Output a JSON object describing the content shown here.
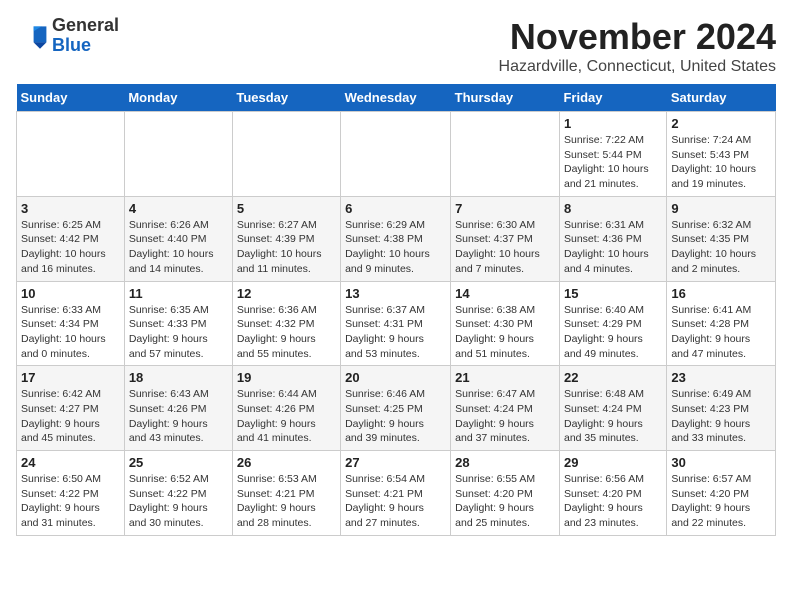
{
  "logo": {
    "line1": "General",
    "line2": "Blue"
  },
  "title": "November 2024",
  "location": "Hazardville, Connecticut, United States",
  "weekdays": [
    "Sunday",
    "Monday",
    "Tuesday",
    "Wednesday",
    "Thursday",
    "Friday",
    "Saturday"
  ],
  "weeks": [
    [
      {
        "day": "",
        "info": ""
      },
      {
        "day": "",
        "info": ""
      },
      {
        "day": "",
        "info": ""
      },
      {
        "day": "",
        "info": ""
      },
      {
        "day": "",
        "info": ""
      },
      {
        "day": "1",
        "info": "Sunrise: 7:22 AM\nSunset: 5:44 PM\nDaylight: 10 hours\nand 21 minutes."
      },
      {
        "day": "2",
        "info": "Sunrise: 7:24 AM\nSunset: 5:43 PM\nDaylight: 10 hours\nand 19 minutes."
      }
    ],
    [
      {
        "day": "3",
        "info": "Sunrise: 6:25 AM\nSunset: 4:42 PM\nDaylight: 10 hours\nand 16 minutes."
      },
      {
        "day": "4",
        "info": "Sunrise: 6:26 AM\nSunset: 4:40 PM\nDaylight: 10 hours\nand 14 minutes."
      },
      {
        "day": "5",
        "info": "Sunrise: 6:27 AM\nSunset: 4:39 PM\nDaylight: 10 hours\nand 11 minutes."
      },
      {
        "day": "6",
        "info": "Sunrise: 6:29 AM\nSunset: 4:38 PM\nDaylight: 10 hours\nand 9 minutes."
      },
      {
        "day": "7",
        "info": "Sunrise: 6:30 AM\nSunset: 4:37 PM\nDaylight: 10 hours\nand 7 minutes."
      },
      {
        "day": "8",
        "info": "Sunrise: 6:31 AM\nSunset: 4:36 PM\nDaylight: 10 hours\nand 4 minutes."
      },
      {
        "day": "9",
        "info": "Sunrise: 6:32 AM\nSunset: 4:35 PM\nDaylight: 10 hours\nand 2 minutes."
      }
    ],
    [
      {
        "day": "10",
        "info": "Sunrise: 6:33 AM\nSunset: 4:34 PM\nDaylight: 10 hours\nand 0 minutes."
      },
      {
        "day": "11",
        "info": "Sunrise: 6:35 AM\nSunset: 4:33 PM\nDaylight: 9 hours\nand 57 minutes."
      },
      {
        "day": "12",
        "info": "Sunrise: 6:36 AM\nSunset: 4:32 PM\nDaylight: 9 hours\nand 55 minutes."
      },
      {
        "day": "13",
        "info": "Sunrise: 6:37 AM\nSunset: 4:31 PM\nDaylight: 9 hours\nand 53 minutes."
      },
      {
        "day": "14",
        "info": "Sunrise: 6:38 AM\nSunset: 4:30 PM\nDaylight: 9 hours\nand 51 minutes."
      },
      {
        "day": "15",
        "info": "Sunrise: 6:40 AM\nSunset: 4:29 PM\nDaylight: 9 hours\nand 49 minutes."
      },
      {
        "day": "16",
        "info": "Sunrise: 6:41 AM\nSunset: 4:28 PM\nDaylight: 9 hours\nand 47 minutes."
      }
    ],
    [
      {
        "day": "17",
        "info": "Sunrise: 6:42 AM\nSunset: 4:27 PM\nDaylight: 9 hours\nand 45 minutes."
      },
      {
        "day": "18",
        "info": "Sunrise: 6:43 AM\nSunset: 4:26 PM\nDaylight: 9 hours\nand 43 minutes."
      },
      {
        "day": "19",
        "info": "Sunrise: 6:44 AM\nSunset: 4:26 PM\nDaylight: 9 hours\nand 41 minutes."
      },
      {
        "day": "20",
        "info": "Sunrise: 6:46 AM\nSunset: 4:25 PM\nDaylight: 9 hours\nand 39 minutes."
      },
      {
        "day": "21",
        "info": "Sunrise: 6:47 AM\nSunset: 4:24 PM\nDaylight: 9 hours\nand 37 minutes."
      },
      {
        "day": "22",
        "info": "Sunrise: 6:48 AM\nSunset: 4:24 PM\nDaylight: 9 hours\nand 35 minutes."
      },
      {
        "day": "23",
        "info": "Sunrise: 6:49 AM\nSunset: 4:23 PM\nDaylight: 9 hours\nand 33 minutes."
      }
    ],
    [
      {
        "day": "24",
        "info": "Sunrise: 6:50 AM\nSunset: 4:22 PM\nDaylight: 9 hours\nand 31 minutes."
      },
      {
        "day": "25",
        "info": "Sunrise: 6:52 AM\nSunset: 4:22 PM\nDaylight: 9 hours\nand 30 minutes."
      },
      {
        "day": "26",
        "info": "Sunrise: 6:53 AM\nSunset: 4:21 PM\nDaylight: 9 hours\nand 28 minutes."
      },
      {
        "day": "27",
        "info": "Sunrise: 6:54 AM\nSunset: 4:21 PM\nDaylight: 9 hours\nand 27 minutes."
      },
      {
        "day": "28",
        "info": "Sunrise: 6:55 AM\nSunset: 4:20 PM\nDaylight: 9 hours\nand 25 minutes."
      },
      {
        "day": "29",
        "info": "Sunrise: 6:56 AM\nSunset: 4:20 PM\nDaylight: 9 hours\nand 23 minutes."
      },
      {
        "day": "30",
        "info": "Sunrise: 6:57 AM\nSunset: 4:20 PM\nDaylight: 9 hours\nand 22 minutes."
      }
    ]
  ]
}
